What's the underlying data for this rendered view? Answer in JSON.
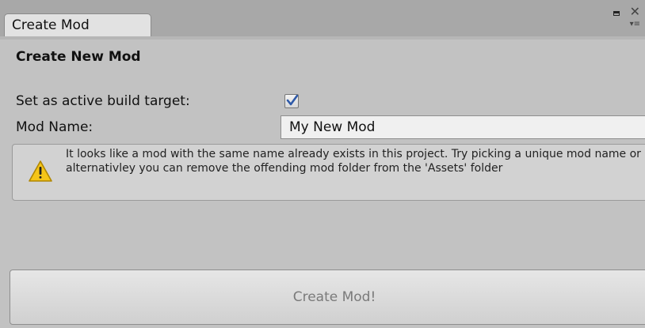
{
  "window": {
    "tab_title": "Create Mod",
    "controls": [
      "maximize-icon",
      "close-icon",
      "menu-icon"
    ]
  },
  "form": {
    "heading": "Create New Mod",
    "build_target_label": "Set as active build target:",
    "build_target_checked": true,
    "mod_name_label": "Mod Name:",
    "mod_name_value": "My New Mod"
  },
  "warning": {
    "icon": "warning-icon",
    "message": "It looks like a mod with the same name already exists in this project. Try picking a unique mod name or alternativley you can remove the offending mod folder from the 'Assets' folder"
  },
  "actions": {
    "create_label": "Create Mod!",
    "create_enabled": false
  },
  "colors": {
    "background": "#c2c2c2",
    "tab_background": "#e2e2e2",
    "checkmark": "#2f5aa8",
    "warning_fill": "#f5c518"
  }
}
